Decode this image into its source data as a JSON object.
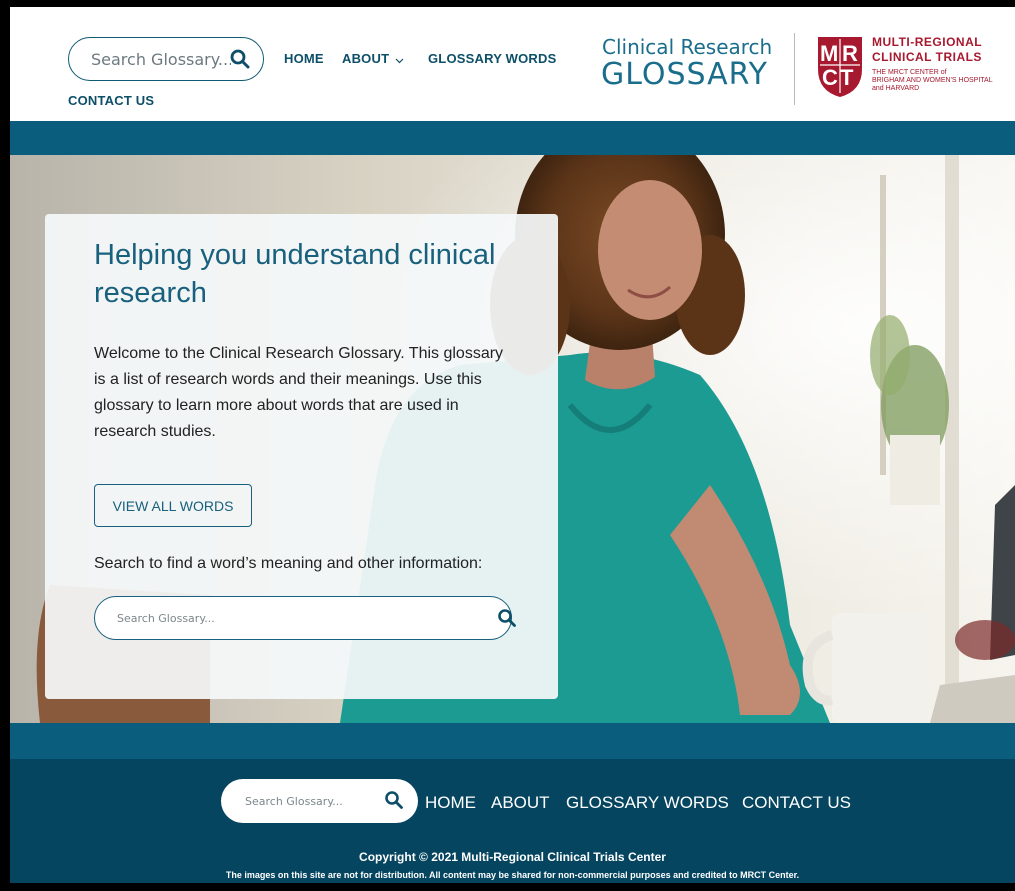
{
  "header": {
    "search_placeholder": "Search Glossary...",
    "nav": {
      "home": "HOME",
      "about": "ABOUT",
      "glossary_words": "GLOSSARY WORDS",
      "contact": "CONTACT US"
    },
    "brand_sub": "Clinical Research",
    "brand_main": "GLOSSARY",
    "mrct_line1": "MULTI-REGIONAL",
    "mrct_line2": "CLINICAL TRIALS",
    "mrct_line3": "THE MRCT CENTER of",
    "mrct_line4": "BRIGHAM AND WOMEN'S HOSPITAL",
    "mrct_line5": "and HARVARD",
    "logo_letters": "MRCT"
  },
  "hero": {
    "title": "Helping you understand clinical research",
    "body": "Welcome to the Clinical Research Glossary. This glossary is a list of research words and their meanings. Use this glossary to learn more about words that are used in research studies.",
    "button": "VIEW ALL WORDS",
    "search_prompt": "Search to find a word’s meaning and other information:",
    "search_placeholder": "Search Glossary..."
  },
  "footer": {
    "search_placeholder": "Search Glossary...",
    "nav": {
      "home": "HOME",
      "about": "ABOUT",
      "glossary_words": "GLOSSARY WORDS",
      "contact": "CONTACT US"
    },
    "copyright": "Copyright © 2021 Multi-Regional Clinical Trials Center",
    "disclaimer": "The images on this site are not for distribution.  All content may be shared for non-commercial purposes and credited to MRCT Center."
  },
  "colors": {
    "primary_teal": "#0b5d7d",
    "footer_navy": "#054560",
    "brand_blue": "#1a6e8c",
    "mrct_red": "#a6192e"
  },
  "icons": [
    "search-icon",
    "chevron-down-icon",
    "mrct-logo"
  ]
}
